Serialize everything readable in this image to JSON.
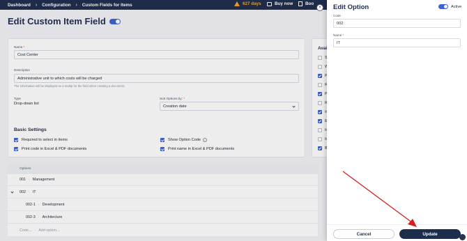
{
  "topbar": {
    "breadcrumbs": [
      "Dashboard",
      "Configuration",
      "Custom Fields for Items"
    ],
    "warning_text": "627 days",
    "buy_label": "Buy now",
    "book_label": "Boo"
  },
  "page": {
    "title": "Edit Custom Item Field",
    "enabled": true
  },
  "form": {
    "name_label": "Name",
    "name_value": "Cost Center",
    "description_label": "Description",
    "description_value": "Administrative unit to which costs will be charged",
    "description_hint": "The information will be displayed as a tooltip for the field when creating a document.",
    "type_label": "Type",
    "type_value": "Drop-down list",
    "sort_label": "Sort Options by:",
    "sort_value": "Creation date",
    "required_mark": "*"
  },
  "basic_settings": {
    "title": "Basic Settings",
    "options": [
      {
        "label": "Required to select in items",
        "checked": true
      },
      {
        "label": "Show Option Code",
        "checked": true,
        "info_icon": true
      },
      {
        "label": "Print code in Excel & PDF documents",
        "checked": true
      },
      {
        "label": "Print name in Excel & PDF documents",
        "checked": true
      }
    ]
  },
  "options_table": {
    "header": "Options",
    "rows": [
      {
        "code": "001",
        "name": "Management",
        "level": 0,
        "expanded": false
      },
      {
        "code": "002",
        "name": "IT",
        "level": 0,
        "expanded": true
      },
      {
        "code": "002-1",
        "name": "Development",
        "level": 1
      },
      {
        "code": "002-3",
        "name": "Architecture",
        "level": 1
      }
    ],
    "new_row": {
      "code_placeholder": "Code...",
      "name_placeholder": "Add option..."
    }
  },
  "available_panel": {
    "title": "Avai",
    "items": [
      {
        "ch": "S",
        "checked": false
      },
      {
        "ch": "W",
        "checked": false
      },
      {
        "ch": "P",
        "checked": true
      },
      {
        "ch": "R",
        "checked": false
      },
      {
        "ch": "P",
        "checked": true
      },
      {
        "ch": "R",
        "checked": false
      },
      {
        "ch": "In",
        "checked": true
      },
      {
        "ch": "E",
        "checked": true
      },
      {
        "ch": "In",
        "checked": false
      },
      {
        "ch": "Ir",
        "checked": false
      },
      {
        "ch": "B",
        "checked": true
      }
    ]
  },
  "drawer": {
    "title": "Edit Option",
    "active_label": "Active",
    "code_label": "Code",
    "code_value": "002",
    "name_label": "Name",
    "name_value": "IT",
    "cancel_label": "Cancel",
    "update_label": "Update",
    "close_symbol": "×"
  },
  "colors": {
    "primary": "#1f2d4d",
    "accent": "#3b63d6",
    "warning": "#f0a630",
    "annotation_arrow": "#d42020"
  }
}
